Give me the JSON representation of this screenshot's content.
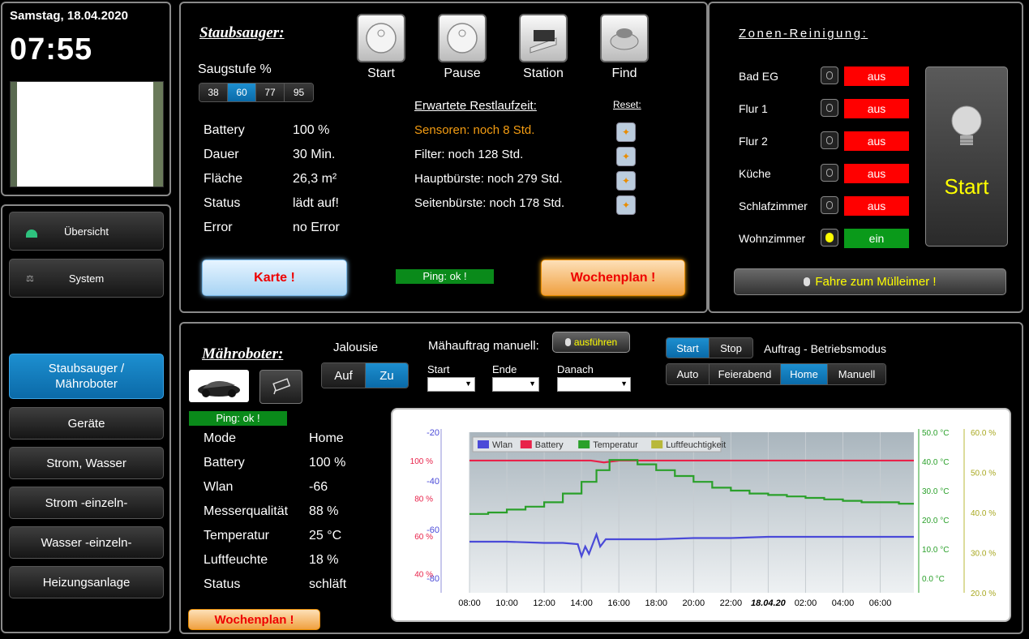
{
  "header": {
    "date": "Samstag, 18.04.2020",
    "time": "07:55"
  },
  "nav": {
    "items": [
      "Übersicht",
      "System",
      "Staubsauger / Mähroboter",
      "Geräte",
      "Strom, Wasser",
      "Strom -einzeln-",
      "Wasser -einzeln-",
      "Heizungsanlage"
    ]
  },
  "vacuum": {
    "title": "Staubsauger:",
    "buttons": [
      "Start",
      "Pause",
      "Station",
      "Find"
    ],
    "suction_label": "Saugstufe %",
    "suction_levels": [
      "38",
      "60",
      "77",
      "95"
    ],
    "suction_selected": "60",
    "stats": [
      {
        "label": "Battery",
        "value": "100 %"
      },
      {
        "label": "Dauer",
        "value": "30 Min."
      },
      {
        "label": "Fläche",
        "value": "26,3 m²"
      },
      {
        "label": "Status",
        "value": "lädt auf!"
      },
      {
        "label": "Error",
        "value": "no Error"
      }
    ],
    "remaining_title": "Erwartete Restlaufzeit:",
    "reset_label": "Reset:",
    "remaining": [
      "Sensoren: noch 8 Std.",
      "Filter: noch 128 Std.",
      "Hauptbürste: noch 279 Std.",
      "Seitenbürste: noch 178 Std."
    ],
    "map_button": "Karte !",
    "ping": "Ping: ok !",
    "weekplan_button": "Wochenplan !"
  },
  "zones": {
    "title": "Zonen-Reinigung:",
    "rooms": [
      {
        "name": "Bad EG",
        "state": "aus"
      },
      {
        "name": "Flur 1",
        "state": "aus"
      },
      {
        "name": "Flur 2",
        "state": "aus"
      },
      {
        "name": "Küche",
        "state": "aus"
      },
      {
        "name": "Schlafzimmer",
        "state": "aus"
      },
      {
        "name": "Wohnzimmer",
        "state": "ein"
      }
    ],
    "start": "Start",
    "trash_button": "Fahre zum Mülleimer !"
  },
  "mower": {
    "title": "Mähroboter:",
    "ping": "Ping: ok !",
    "stats": [
      {
        "label": "Mode",
        "value": "Home"
      },
      {
        "label": "Battery",
        "value": "100 %"
      },
      {
        "label": "Wlan",
        "value": "-66"
      },
      {
        "label": "Messerqualität",
        "value": "88 %"
      },
      {
        "label": "Temperatur",
        "value": "25 °C"
      },
      {
        "label": "Luftfeuchte",
        "value": "18 %"
      },
      {
        "label": "Status",
        "value": "schläft"
      }
    ],
    "weekplan_button": "Wochenplan !",
    "blind_label": "Jalousie",
    "blind_options": [
      "Auf",
      "Zu"
    ],
    "blind_selected": "Zu",
    "manual_label": "Mähauftrag manuell:",
    "execute_button": "ausführen",
    "selects": [
      "Start",
      "Ende",
      "Danach"
    ],
    "startstop": [
      "Start",
      "Stop"
    ],
    "startstop_selected": "Start",
    "order_label": "Auftrag - Betriebsmodus",
    "modes": [
      "Auto",
      "Feierabend",
      "Home",
      "Manuell"
    ],
    "mode_selected": "Home"
  },
  "chart_data": {
    "type": "line",
    "legend": [
      "Wlan",
      "Battery",
      "Temperatur",
      "Luftfeuchtigkeit"
    ],
    "colors": {
      "Wlan": "#4a4ad8",
      "Battery": "#e8224a",
      "Temperatur": "#2aa02a",
      "Luftfeuchtigkeit": "#b8b83a"
    },
    "x_ticks": [
      "08:00",
      "10:00",
      "12:00",
      "14:00",
      "16:00",
      "18:00",
      "20:00",
      "22:00",
      "18.04.20",
      "02:00",
      "04:00",
      "06:00"
    ],
    "x_range_hours": [
      8,
      31.8
    ],
    "y_axes": {
      "wlan": {
        "ticks": [
          "-20",
          "-40",
          "-60",
          "-80"
        ],
        "range": [
          -86,
          -20
        ]
      },
      "battery": {
        "ticks": [
          "100 %",
          "80 %",
          "60 %",
          "40 %"
        ],
        "range": [
          30,
          115
        ]
      },
      "temperature": {
        "ticks": [
          "50.0 °C",
          "40.0 °C",
          "30.0 °C",
          "20.0 °C",
          "10.0 °C",
          "0.0 °C"
        ],
        "range": [
          -5,
          50
        ]
      },
      "humidity": {
        "ticks": [
          "60.0 %",
          "50.0 %",
          "40.0 %",
          "30.0 %",
          "20.0 %"
        ],
        "range": [
          20,
          60
        ]
      }
    },
    "series": [
      {
        "name": "Battery",
        "x": [
          8,
          14.5,
          15.2,
          16,
          31.8
        ],
        "y": [
          100,
          100,
          99,
          100,
          100
        ]
      },
      {
        "name": "Temperatur",
        "x": [
          8,
          9,
          10,
          11,
          12,
          13,
          14,
          14.8,
          15.5,
          16,
          17,
          18,
          19,
          20,
          21,
          22,
          23,
          24,
          25,
          26,
          27,
          28,
          29,
          30,
          31,
          31.8
        ],
        "y": [
          22,
          22.5,
          23.5,
          24.5,
          26,
          29,
          33,
          37,
          40.5,
          40.5,
          39,
          37,
          35,
          33,
          31,
          30,
          29,
          28.5,
          28,
          27.5,
          27,
          26.5,
          26,
          26,
          25.5,
          25.5
        ]
      },
      {
        "name": "Wlan",
        "x": [
          8,
          10,
          12,
          13,
          13.8,
          14,
          14.2,
          14.4,
          14.6,
          14.8,
          15,
          15.3,
          16,
          18,
          20,
          22,
          24,
          26,
          28,
          30,
          31.8
        ],
        "y": [
          -65,
          -65,
          -65.5,
          -65.5,
          -66,
          -71,
          -67,
          -70,
          -66,
          -62,
          -67,
          -64,
          -64,
          -64,
          -63.5,
          -63.5,
          -63,
          -63,
          -63,
          -63,
          -63
        ]
      }
    ]
  }
}
